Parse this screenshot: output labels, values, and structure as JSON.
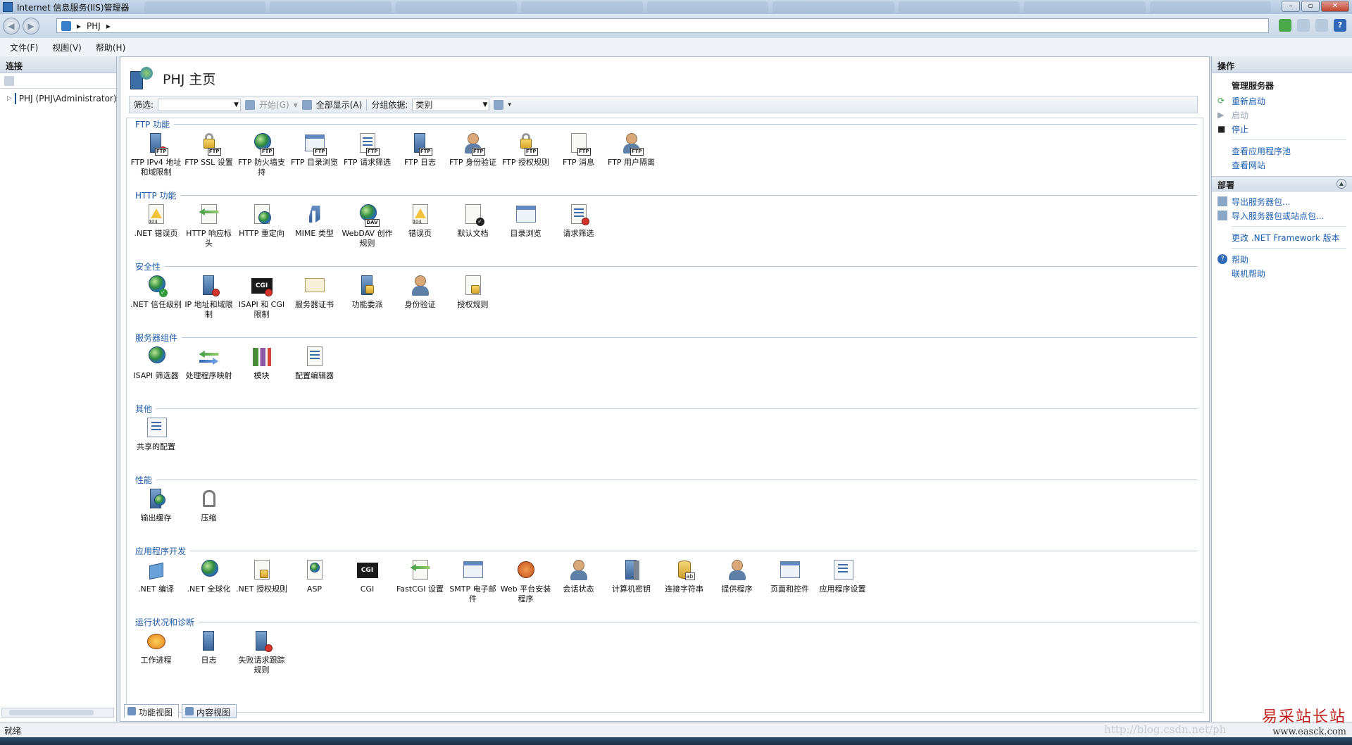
{
  "window": {
    "title": "Internet 信息服务(IIS)管理器"
  },
  "nav": {
    "breadcrumb": "PHJ",
    "separator": "▸"
  },
  "menu": [
    {
      "label": "文件(F)"
    },
    {
      "label": "视图(V)"
    },
    {
      "label": "帮助(H)"
    }
  ],
  "left": {
    "header": "连接",
    "tree_node": "PHJ (PHJ\\Administrator)"
  },
  "page": {
    "title": "PHJ 主页"
  },
  "filter": {
    "filter_label": "筛选:",
    "start_label": "开始(G)",
    "show_all_label": "全部显示(A)",
    "group_by_label": "分组依据:",
    "group_by_value": "类别"
  },
  "groups": [
    {
      "title": "FTP 功能",
      "items": [
        {
          "label": "FTP IPv4 地址和域限制",
          "icon": "ftp-ipv4-icon"
        },
        {
          "label": "FTP SSL 设置",
          "icon": "ftp-ssl-icon"
        },
        {
          "label": "FTP 防火墙支持",
          "icon": "ftp-firewall-icon"
        },
        {
          "label": "FTP 目录浏览",
          "icon": "ftp-directory-browse-icon"
        },
        {
          "label": "FTP 请求筛选",
          "icon": "ftp-request-filter-icon"
        },
        {
          "label": "FTP 日志",
          "icon": "ftp-log-icon"
        },
        {
          "label": "FTP 身份验证",
          "icon": "ftp-authentication-icon"
        },
        {
          "label": "FTP 授权规则",
          "icon": "ftp-authorization-icon"
        },
        {
          "label": "FTP 消息",
          "icon": "ftp-message-icon"
        },
        {
          "label": "FTP 用户隔离",
          "icon": "ftp-user-isolation-icon"
        }
      ]
    },
    {
      "title": "HTTP 功能",
      "items": [
        {
          "label": ".NET 错误页",
          "icon": "net-error-page-icon"
        },
        {
          "label": "HTTP 响应标头",
          "icon": "http-response-headers-icon"
        },
        {
          "label": "HTTP 重定向",
          "icon": "http-redirect-icon"
        },
        {
          "label": "MIME 类型",
          "icon": "mime-types-icon"
        },
        {
          "label": "WebDAV 创作规则",
          "icon": "webdav-icon"
        },
        {
          "label": "错误页",
          "icon": "error-page-icon"
        },
        {
          "label": "默认文档",
          "icon": "default-document-icon"
        },
        {
          "label": "目录浏览",
          "icon": "directory-browse-icon"
        },
        {
          "label": "请求筛选",
          "icon": "request-filter-icon"
        }
      ]
    },
    {
      "title": "安全性",
      "items": [
        {
          "label": ".NET 信任级别",
          "icon": "net-trust-level-icon"
        },
        {
          "label": "IP 地址和域限制",
          "icon": "ip-restrictions-icon"
        },
        {
          "label": "ISAPI 和 CGI 限制",
          "icon": "isapi-cgi-restrictions-icon"
        },
        {
          "label": "服务器证书",
          "icon": "server-certificates-icon"
        },
        {
          "label": "功能委派",
          "icon": "feature-delegation-icon"
        },
        {
          "label": "身份验证",
          "icon": "authentication-icon"
        },
        {
          "label": "授权规则",
          "icon": "authorization-rules-icon"
        }
      ]
    },
    {
      "title": "服务器组件",
      "items": [
        {
          "label": "ISAPI 筛选器",
          "icon": "isapi-filters-icon"
        },
        {
          "label": "处理程序映射",
          "icon": "handler-mappings-icon"
        },
        {
          "label": "模块",
          "icon": "modules-icon"
        },
        {
          "label": "配置编辑器",
          "icon": "configuration-editor-icon"
        }
      ]
    },
    {
      "title": "其他",
      "items": [
        {
          "label": "共享的配置",
          "icon": "shared-configuration-icon"
        }
      ]
    },
    {
      "title": "性能",
      "items": [
        {
          "label": "输出缓存",
          "icon": "output-caching-icon"
        },
        {
          "label": "压缩",
          "icon": "compression-icon"
        }
      ]
    },
    {
      "title": "应用程序开发",
      "items": [
        {
          "label": ".NET 编译",
          "icon": "net-compilation-icon"
        },
        {
          "label": ".NET 全球化",
          "icon": "net-globalization-icon"
        },
        {
          "label": ".NET 授权规则",
          "icon": "net-authorization-icon"
        },
        {
          "label": "ASP",
          "icon": "asp-icon"
        },
        {
          "label": "CGI",
          "icon": "cgi-icon"
        },
        {
          "label": "FastCGI 设置",
          "icon": "fastcgi-icon"
        },
        {
          "label": "SMTP 电子邮件",
          "icon": "smtp-email-icon"
        },
        {
          "label": "Web 平台安装程序",
          "icon": "web-platform-installer-icon"
        },
        {
          "label": "会话状态",
          "icon": "session-state-icon"
        },
        {
          "label": "计算机密钥",
          "icon": "machine-key-icon"
        },
        {
          "label": "连接字符串",
          "icon": "connection-strings-icon"
        },
        {
          "label": "提供程序",
          "icon": "providers-icon"
        },
        {
          "label": "页面和控件",
          "icon": "pages-controls-icon"
        },
        {
          "label": "应用程序设置",
          "icon": "application-settings-icon"
        }
      ]
    },
    {
      "title": "运行状况和诊断",
      "items": [
        {
          "label": "工作进程",
          "icon": "worker-processes-icon"
        },
        {
          "label": "日志",
          "icon": "logging-icon"
        },
        {
          "label": "失败请求跟踪规则",
          "icon": "failed-request-tracing-icon"
        }
      ]
    }
  ],
  "view_tabs": {
    "features": "功能视图",
    "content": "内容视图"
  },
  "actions": {
    "header": "操作",
    "manage_server": "管理服务器",
    "restart": "重新启动",
    "start": "启动",
    "stop": "停止",
    "view_app_pools": "查看应用程序池",
    "view_sites": "查看网站",
    "deploy_header": "部署",
    "export_package": "导出服务器包...",
    "import_package": "导入服务器包或站点包...",
    "change_framework": "更改 .NET Framework 版本",
    "help": "帮助",
    "online_help": "联机帮助"
  },
  "status": {
    "text": "就绪"
  },
  "watermark": {
    "brand": "易采站长站",
    "url": "www.easck.com",
    "blog": "http://blog.csdn.net/ph"
  },
  "colors": {
    "accent": "#1d5fb0",
    "group_title": "#1f5ba6"
  }
}
